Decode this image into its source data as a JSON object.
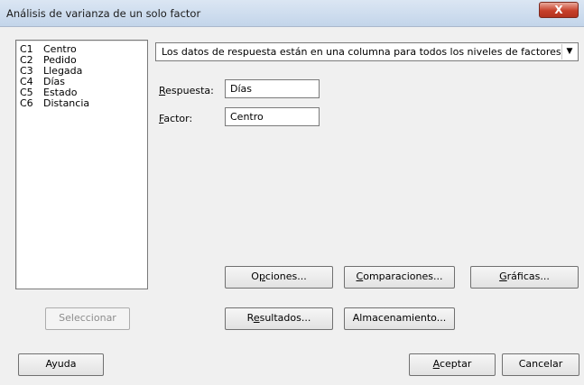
{
  "window": {
    "title": "Análisis de varianza de un solo factor",
    "close_glyph": "X"
  },
  "variables": [
    {
      "code": "C1",
      "name": "Centro"
    },
    {
      "code": "C2",
      "name": "Pedido"
    },
    {
      "code": "C3",
      "name": "Llegada"
    },
    {
      "code": "C4",
      "name": "Días"
    },
    {
      "code": "C5",
      "name": "Estado"
    },
    {
      "code": "C6",
      "name": "Distancia"
    }
  ],
  "data_format": {
    "selected": "Los datos de respuesta están en una columna para todos los niveles de factores"
  },
  "fields": {
    "response": {
      "label_key": "R",
      "label_rest": "espuesta:",
      "value": "Días"
    },
    "factor": {
      "label_key": "F",
      "label_rest": "actor:",
      "value": "Centro"
    }
  },
  "buttons": {
    "options": {
      "pre": "O",
      "key": "p",
      "post": "ciones..."
    },
    "comparisons": {
      "pre": "",
      "key": "C",
      "post": "omparaciones..."
    },
    "graphs": {
      "pre": "",
      "key": "G",
      "post": "ráficas..."
    },
    "results": {
      "pre": "R",
      "key": "e",
      "post": "sultados..."
    },
    "storage": {
      "label": "Almacenamiento..."
    },
    "select": {
      "label": "Seleccionar"
    },
    "help": {
      "label": "Ayuda"
    },
    "accept": {
      "pre": "",
      "key": "A",
      "post": "ceptar"
    },
    "cancel": {
      "label": "Cancelar"
    }
  }
}
